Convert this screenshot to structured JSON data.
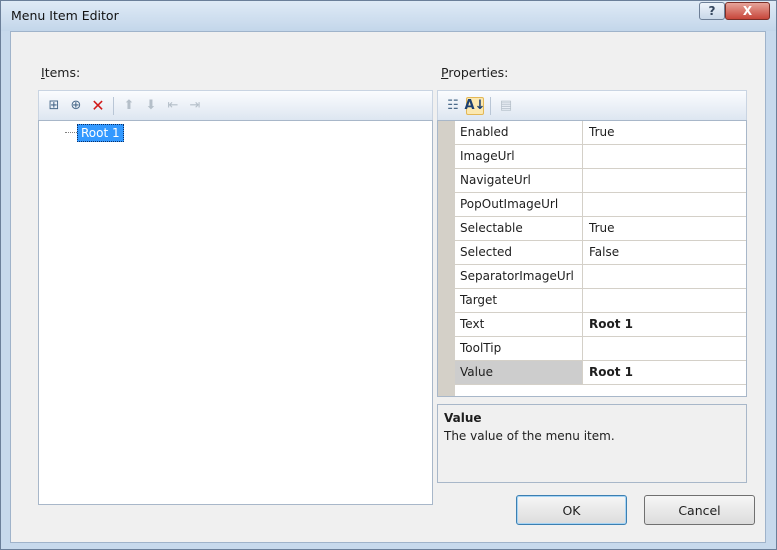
{
  "window": {
    "title": "Menu Item Editor",
    "help_glyph": "?",
    "close_glyph": "X"
  },
  "items_panel": {
    "label_prefix": "",
    "label_access": "I",
    "label_rest": "tems:",
    "tools": [
      {
        "icon": "add-root-item-icon",
        "glyph": "⊞",
        "state": "enabled"
      },
      {
        "icon": "add-child-item-icon",
        "glyph": "⊕",
        "state": "enabled"
      },
      {
        "icon": "delete-icon",
        "glyph": "✕",
        "state": "enabled"
      },
      {
        "icon": "move-up-icon",
        "glyph": "⬆",
        "state": "disabled"
      },
      {
        "icon": "move-down-icon",
        "glyph": "⬇",
        "state": "disabled"
      },
      {
        "icon": "outdent-icon",
        "glyph": "⇤",
        "state": "disabled"
      },
      {
        "icon": "indent-icon",
        "glyph": "⇥",
        "state": "disabled"
      }
    ],
    "tree": [
      {
        "label": "Root 1",
        "selected": true
      }
    ]
  },
  "properties_panel": {
    "label_access": "P",
    "label_rest": "roperties:",
    "tools": [
      {
        "icon": "categorized-icon",
        "glyph": "☷"
      },
      {
        "icon": "alphabetical-icon",
        "glyph": "A↓"
      },
      {
        "icon": "property-pages-icon",
        "glyph": "▤"
      }
    ],
    "rows": [
      {
        "name": "Enabled",
        "value": "True",
        "bold": false
      },
      {
        "name": "ImageUrl",
        "value": "",
        "bold": false
      },
      {
        "name": "NavigateUrl",
        "value": "",
        "bold": false
      },
      {
        "name": "PopOutImageUrl",
        "value": "",
        "bold": false
      },
      {
        "name": "Selectable",
        "value": "True",
        "bold": false
      },
      {
        "name": "Selected",
        "value": "False",
        "bold": false
      },
      {
        "name": "SeparatorImageUrl",
        "value": "",
        "bold": false
      },
      {
        "name": "Target",
        "value": "",
        "bold": false
      },
      {
        "name": "Text",
        "value": "Root 1",
        "bold": true
      },
      {
        "name": "ToolTip",
        "value": "",
        "bold": false
      },
      {
        "name": "Value",
        "value": "Root 1",
        "bold": true,
        "selected": true
      }
    ],
    "description": {
      "title": "Value",
      "text": "The value of the menu item."
    }
  },
  "buttons": {
    "ok": "OK",
    "cancel": "Cancel"
  },
  "colors": {
    "selection": "#3399ff",
    "window_frame": "#c7d9ec",
    "close_button": "#c7463a"
  }
}
